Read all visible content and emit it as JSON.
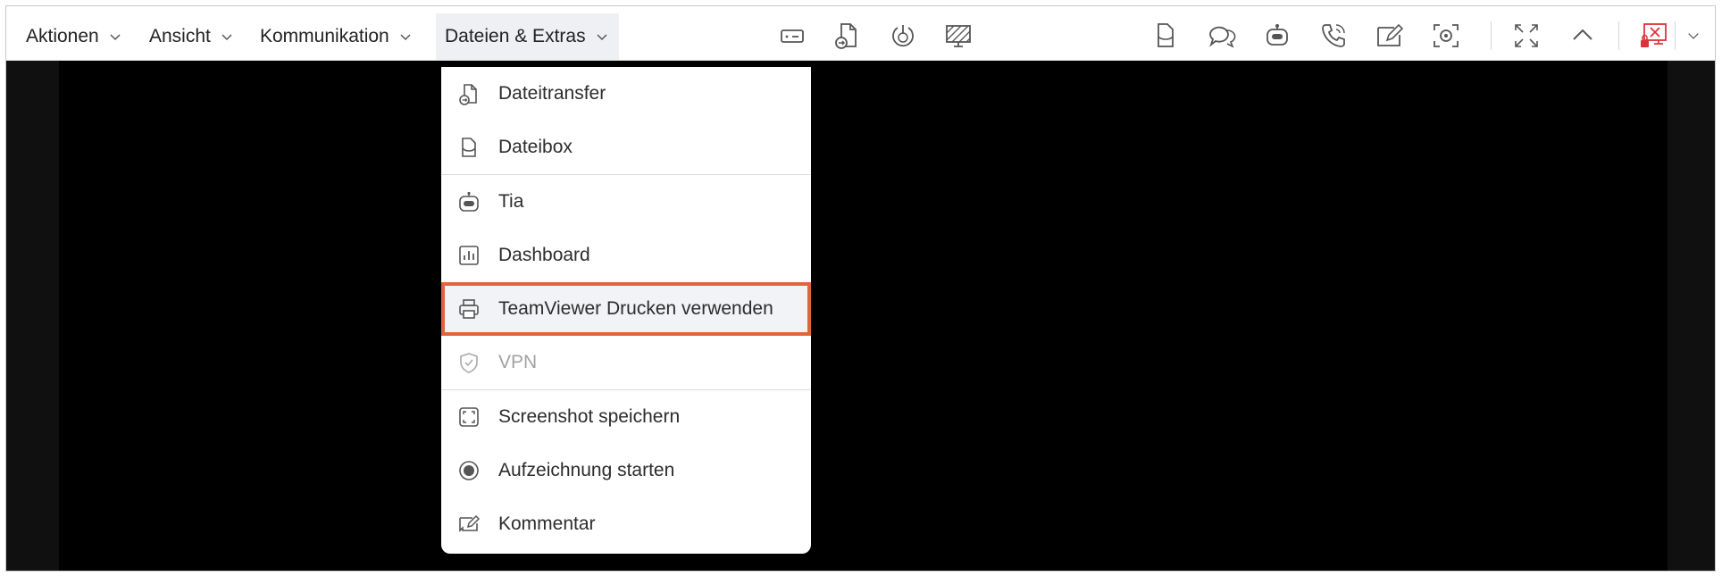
{
  "toolbar": {
    "menus": [
      {
        "label": "Aktionen"
      },
      {
        "label": "Ansicht"
      },
      {
        "label": "Kommunikation"
      },
      {
        "label": "Dateien & Extras"
      }
    ],
    "icons": [
      "remote-screen-icon",
      "file-transfer-icon",
      "power-restart-icon",
      "disable-screen-icon",
      "file-box-icon",
      "chat-icon",
      "tia-robot-icon",
      "call-icon",
      "comment-pen-icon",
      "screenshot-camera-icon",
      "fullscreen-icon",
      "collapse-up-icon",
      "end-session-icon",
      "more-chevron-icon"
    ],
    "accent_red": "#d9343a"
  },
  "dropdown": {
    "items": [
      {
        "label": "Dateitransfer",
        "icon": "file-transfer-icon"
      },
      {
        "label": "Dateibox",
        "icon": "file-box-icon"
      },
      {
        "label": "Tia",
        "icon": "tia-robot-icon"
      },
      {
        "label": "Dashboard",
        "icon": "dashboard-icon"
      },
      {
        "label": "TeamViewer Drucken verwenden",
        "icon": "printer-icon",
        "highlighted": true
      },
      {
        "label": "VPN",
        "icon": "shield-check-icon",
        "disabled": true
      },
      {
        "label": "Screenshot speichern",
        "icon": "screenshot-icon"
      },
      {
        "label": "Aufzeichnung starten",
        "icon": "record-icon"
      },
      {
        "label": "Kommentar",
        "icon": "comment-icon"
      }
    ],
    "highlight_color": "#e0643e"
  }
}
